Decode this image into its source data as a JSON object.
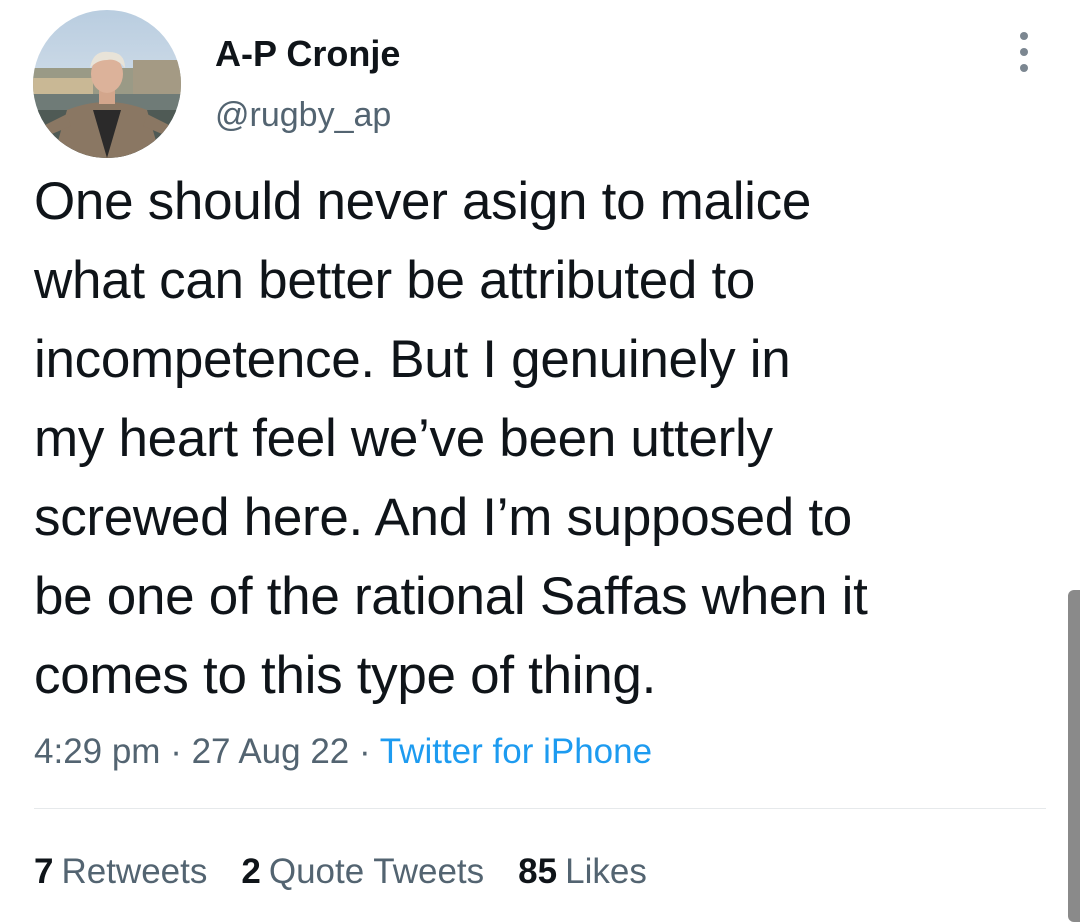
{
  "tweet": {
    "author": {
      "name": "A-P Cronje",
      "handle": "@rugby_ap"
    },
    "text_lines": [
      "One should never asign to malice",
      "what can better be attributed to",
      "incompetence. But I genuinely in",
      "my heart feel we’ve been utterly",
      "screwed here. And I’m supposed to",
      "be one of the rational Saffas when it",
      "comes to this type of thing."
    ],
    "time": "4:29 pm",
    "date": "27 Aug 22",
    "separator": "·",
    "source": "Twitter for iPhone",
    "stats": {
      "retweets_count": "7",
      "retweets_label": "Retweets",
      "quotes_count": "2",
      "quotes_label": "Quote Tweets",
      "likes_count": "85",
      "likes_label": "Likes"
    }
  },
  "icons": {
    "more": "more-options-icon"
  },
  "colors": {
    "text_primary": "#0f1419",
    "text_secondary": "#536471",
    "link": "#1d9bf0",
    "divider": "#e6e9eb"
  }
}
